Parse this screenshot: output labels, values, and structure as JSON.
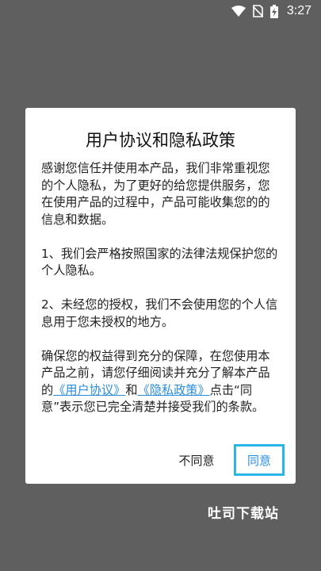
{
  "status_bar": {
    "time": "3:27",
    "icons": [
      "wifi-icon",
      "no-sim-icon",
      "battery-charging-icon"
    ]
  },
  "dialog": {
    "title": "用户协议和隐私政策",
    "paragraph1": "感谢您信任并使用本产品，我们非常重视您的个人隐私，为了更好的给您提供服务，您在使用产品的过程中，产品可能收集您的的信息和数据。",
    "paragraph2": "1、我们会严格按照国家的法律法规保护您的个人隐私。",
    "paragraph3": "2、未经您的授权，我们不会使用您的个人信息用于您未授权的地方。",
    "paragraph4": {
      "prefix": "确保您的权益得到充分的保障，在您使用本产品之前，请您仔细阅读并充分了解本产品的",
      "link_user_agreement": "《用户协议》",
      "conjunction": "和",
      "link_privacy_policy": "《隐私政策》",
      "suffix": "点击“同意”表示您已完全清楚并接受我们的条款。"
    },
    "decline_label": "不同意",
    "agree_label": "同意"
  },
  "watermark": "吐司下载站",
  "colors": {
    "backdrop": "#5f5f5f",
    "link": "#2a8de0",
    "highlight_border": "#29b6e8"
  }
}
